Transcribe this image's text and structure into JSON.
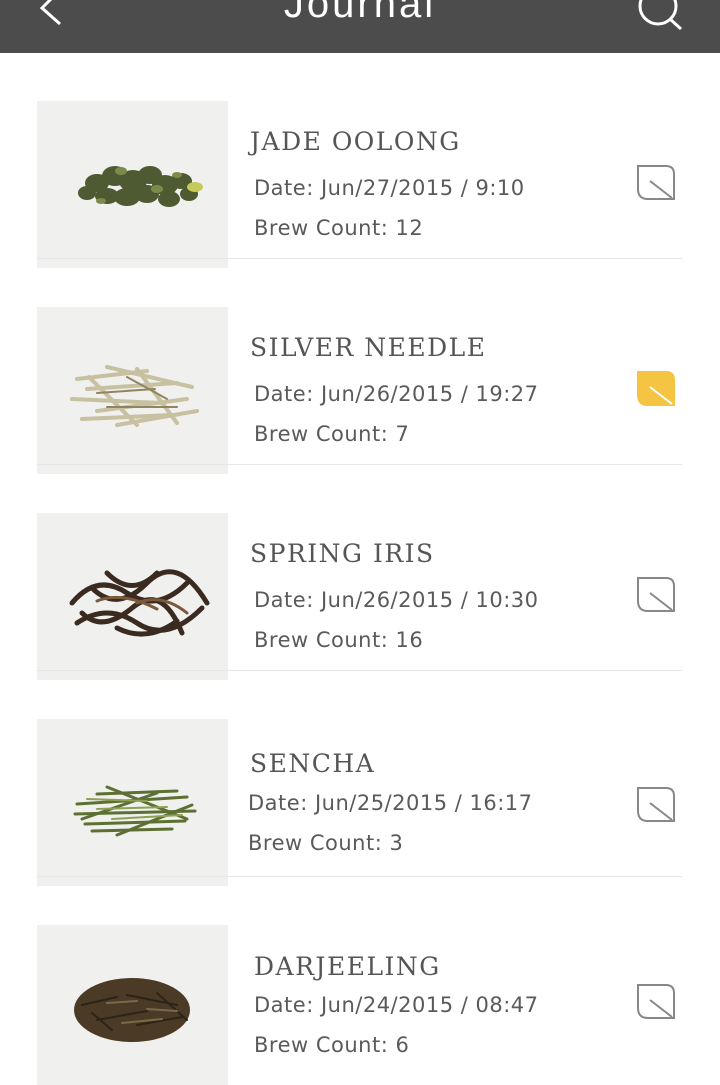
{
  "header": {
    "title": "Journal",
    "back_icon": "chevron-left-icon",
    "search_icon": "search-icon"
  },
  "entries": [
    {
      "name": "JADE OOLONG",
      "date": "Date: Jun/27/2015 / 9:10",
      "brew": "Brew Count: 12",
      "favorite": false,
      "leaf_color": "#d97a00",
      "leaf_style": "clumps"
    },
    {
      "name": "SILVER NEEDLE",
      "date": "Date: Jun/26/2015 / 19:27",
      "brew": "Brew Count: 7",
      "favorite": true,
      "leaf_color": "#c9c2a2",
      "leaf_style": "needles"
    },
    {
      "name": "SPRING IRIS",
      "date": "Date: Jun/26/2015 / 10:30",
      "brew": "Brew Count: 16",
      "favorite": false,
      "leaf_color": "#3b2a20",
      "leaf_style": "twists"
    },
    {
      "name": "SENCHA",
      "date": "Date: Jun/25/2015 / 16:17",
      "brew": "Brew Count: 3",
      "favorite": false,
      "leaf_color": "#5d7035",
      "leaf_style": "shreds"
    },
    {
      "name": "DARJEELING",
      "date": "Date: Jun/24/2015 / 08:47",
      "brew": "Brew Count: 6",
      "favorite": false,
      "leaf_color": "#4a3a28",
      "leaf_style": "fine"
    }
  ],
  "colors": {
    "header_bg": "#4c4c4c",
    "favorite_leaf": "#f6c443",
    "outline_leaf": "#888888"
  }
}
